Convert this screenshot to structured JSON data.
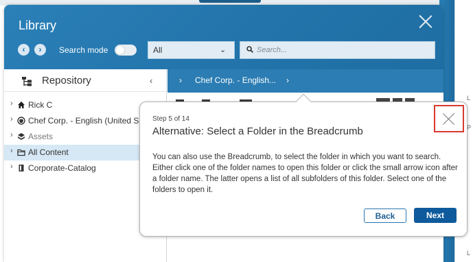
{
  "dialog": {
    "title": "Library",
    "search_mode_label": "Search mode",
    "scope_value": "All",
    "search_placeholder": "Search..."
  },
  "left_pane": {
    "title": "Repository",
    "items": [
      {
        "label": "Rick C",
        "icon": "home-icon"
      },
      {
        "label": "Chef Corp. - English (United S",
        "icon": "site-icon"
      },
      {
        "label": "Assets",
        "icon": "asset-icon"
      },
      {
        "label": "All Content",
        "icon": "folder-icon",
        "selected": true
      },
      {
        "label": "Corporate-Catalog",
        "icon": "catalog-icon"
      }
    ]
  },
  "breadcrumb": {
    "folder": "Chef Corp. - English..."
  },
  "tour": {
    "step": "Step 5 of 14",
    "title": "Alternative: Select a Folder in the Breadcrumb",
    "body": "You can also use the Breadcrumb, to select the folder in which you want to search. Either click one of the folder names to open this folder or click the small arrow icon after a folder name. The latter opens a list of all subfolders of this folder. Select one of the folders to open it.",
    "back_label": "Back",
    "next_label": "Next"
  },
  "colors": {
    "header_blue": "#2274aa",
    "breadcrumb_blue": "#2c7db3",
    "next_button": "#0e5a9c",
    "close_highlight": "#d9382f",
    "selected_row": "#d6e8f5"
  }
}
